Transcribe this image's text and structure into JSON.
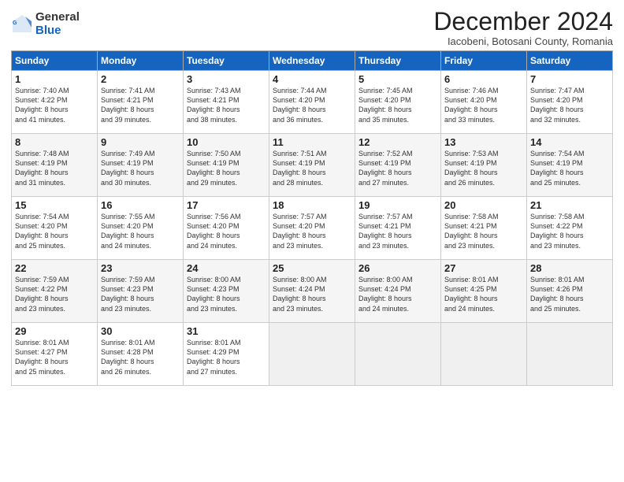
{
  "logo": {
    "general": "General",
    "blue": "Blue"
  },
  "title": "December 2024",
  "location": "Iacobeni, Botosani County, Romania",
  "headers": [
    "Sunday",
    "Monday",
    "Tuesday",
    "Wednesday",
    "Thursday",
    "Friday",
    "Saturday"
  ],
  "weeks": [
    [
      {
        "day": "1",
        "text": "Sunrise: 7:40 AM\nSunset: 4:22 PM\nDaylight: 8 hours\nand 41 minutes."
      },
      {
        "day": "2",
        "text": "Sunrise: 7:41 AM\nSunset: 4:21 PM\nDaylight: 8 hours\nand 39 minutes."
      },
      {
        "day": "3",
        "text": "Sunrise: 7:43 AM\nSunset: 4:21 PM\nDaylight: 8 hours\nand 38 minutes."
      },
      {
        "day": "4",
        "text": "Sunrise: 7:44 AM\nSunset: 4:20 PM\nDaylight: 8 hours\nand 36 minutes."
      },
      {
        "day": "5",
        "text": "Sunrise: 7:45 AM\nSunset: 4:20 PM\nDaylight: 8 hours\nand 35 minutes."
      },
      {
        "day": "6",
        "text": "Sunrise: 7:46 AM\nSunset: 4:20 PM\nDaylight: 8 hours\nand 33 minutes."
      },
      {
        "day": "7",
        "text": "Sunrise: 7:47 AM\nSunset: 4:20 PM\nDaylight: 8 hours\nand 32 minutes."
      }
    ],
    [
      {
        "day": "8",
        "text": "Sunrise: 7:48 AM\nSunset: 4:19 PM\nDaylight: 8 hours\nand 31 minutes."
      },
      {
        "day": "9",
        "text": "Sunrise: 7:49 AM\nSunset: 4:19 PM\nDaylight: 8 hours\nand 30 minutes."
      },
      {
        "day": "10",
        "text": "Sunrise: 7:50 AM\nSunset: 4:19 PM\nDaylight: 8 hours\nand 29 minutes."
      },
      {
        "day": "11",
        "text": "Sunrise: 7:51 AM\nSunset: 4:19 PM\nDaylight: 8 hours\nand 28 minutes."
      },
      {
        "day": "12",
        "text": "Sunrise: 7:52 AM\nSunset: 4:19 PM\nDaylight: 8 hours\nand 27 minutes."
      },
      {
        "day": "13",
        "text": "Sunrise: 7:53 AM\nSunset: 4:19 PM\nDaylight: 8 hours\nand 26 minutes."
      },
      {
        "day": "14",
        "text": "Sunrise: 7:54 AM\nSunset: 4:19 PM\nDaylight: 8 hours\nand 25 minutes."
      }
    ],
    [
      {
        "day": "15",
        "text": "Sunrise: 7:54 AM\nSunset: 4:20 PM\nDaylight: 8 hours\nand 25 minutes."
      },
      {
        "day": "16",
        "text": "Sunrise: 7:55 AM\nSunset: 4:20 PM\nDaylight: 8 hours\nand 24 minutes."
      },
      {
        "day": "17",
        "text": "Sunrise: 7:56 AM\nSunset: 4:20 PM\nDaylight: 8 hours\nand 24 minutes."
      },
      {
        "day": "18",
        "text": "Sunrise: 7:57 AM\nSunset: 4:20 PM\nDaylight: 8 hours\nand 23 minutes."
      },
      {
        "day": "19",
        "text": "Sunrise: 7:57 AM\nSunset: 4:21 PM\nDaylight: 8 hours\nand 23 minutes."
      },
      {
        "day": "20",
        "text": "Sunrise: 7:58 AM\nSunset: 4:21 PM\nDaylight: 8 hours\nand 23 minutes."
      },
      {
        "day": "21",
        "text": "Sunrise: 7:58 AM\nSunset: 4:22 PM\nDaylight: 8 hours\nand 23 minutes."
      }
    ],
    [
      {
        "day": "22",
        "text": "Sunrise: 7:59 AM\nSunset: 4:22 PM\nDaylight: 8 hours\nand 23 minutes."
      },
      {
        "day": "23",
        "text": "Sunrise: 7:59 AM\nSunset: 4:23 PM\nDaylight: 8 hours\nand 23 minutes."
      },
      {
        "day": "24",
        "text": "Sunrise: 8:00 AM\nSunset: 4:23 PM\nDaylight: 8 hours\nand 23 minutes."
      },
      {
        "day": "25",
        "text": "Sunrise: 8:00 AM\nSunset: 4:24 PM\nDaylight: 8 hours\nand 23 minutes."
      },
      {
        "day": "26",
        "text": "Sunrise: 8:00 AM\nSunset: 4:24 PM\nDaylight: 8 hours\nand 24 minutes."
      },
      {
        "day": "27",
        "text": "Sunrise: 8:01 AM\nSunset: 4:25 PM\nDaylight: 8 hours\nand 24 minutes."
      },
      {
        "day": "28",
        "text": "Sunrise: 8:01 AM\nSunset: 4:26 PM\nDaylight: 8 hours\nand 25 minutes."
      }
    ],
    [
      {
        "day": "29",
        "text": "Sunrise: 8:01 AM\nSunset: 4:27 PM\nDaylight: 8 hours\nand 25 minutes."
      },
      {
        "day": "30",
        "text": "Sunrise: 8:01 AM\nSunset: 4:28 PM\nDaylight: 8 hours\nand 26 minutes."
      },
      {
        "day": "31",
        "text": "Sunrise: 8:01 AM\nSunset: 4:29 PM\nDaylight: 8 hours\nand 27 minutes."
      },
      {
        "day": "",
        "text": ""
      },
      {
        "day": "",
        "text": ""
      },
      {
        "day": "",
        "text": ""
      },
      {
        "day": "",
        "text": ""
      }
    ]
  ]
}
